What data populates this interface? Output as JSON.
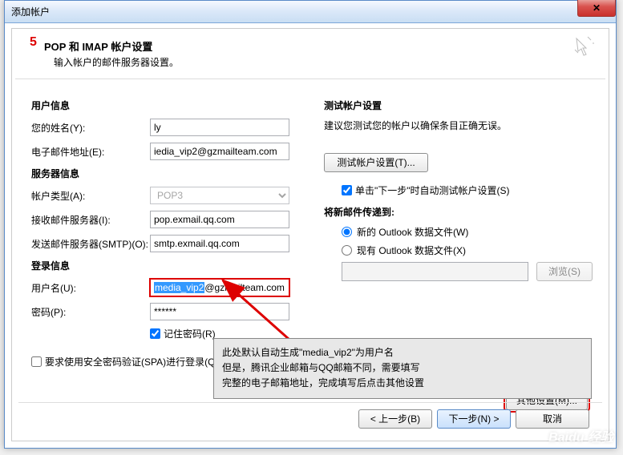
{
  "window": {
    "title": "添加帐户",
    "close_glyph": "✕"
  },
  "step_number": "5",
  "header": {
    "title": "POP 和 IMAP 帐户设置",
    "subtitle": "输入帐户的邮件服务器设置。"
  },
  "left": {
    "user_section": "用户信息",
    "name_label": "您的姓名(Y):",
    "name_value": "ly",
    "email_label": "电子邮件地址(E):",
    "email_value": "iedia_vip2@gzmailteam.com",
    "server_section": "服务器信息",
    "acct_type_label": "帐户类型(A):",
    "acct_type_value": "POP3",
    "incoming_label": "接收邮件服务器(I):",
    "incoming_value": "pop.exmail.qq.com",
    "outgoing_label": "发送邮件服务器(SMTP)(O):",
    "outgoing_value": "smtp.exmail.qq.com",
    "login_section": "登录信息",
    "user_label": "用户名(U):",
    "user_value_sel": "media_vip2",
    "user_value_rest": "@gzmailteam.com",
    "pass_label": "密码(P):",
    "pass_value": "******",
    "remember_label": "记住密码(R)",
    "spa_label": "要求使用安全密码验证(SPA)进行登录(Q)"
  },
  "right": {
    "test_section": "测试帐户设置",
    "test_desc": "建议您测试您的帐户以确保条目正确无误。",
    "test_btn": "测试帐户设置(T)...",
    "auto_test_label": "单击\"下一步\"时自动测试帐户设置(S)",
    "deliver_section": "将新邮件传递到:",
    "radio_new": "新的 Outlook 数据文件(W)",
    "radio_existing": "现有 Outlook 数据文件(X)",
    "browse_btn": "浏览(S)",
    "more_btn": "其他设置(M)..."
  },
  "footer": {
    "back": "< 上一步(B)",
    "next": "下一步(N) >",
    "cancel": "取消"
  },
  "annotation": {
    "l1": "此处默认自动生成\"media_vip2\"为用户名",
    "l2": "但是，腾讯企业邮箱与QQ邮箱不同，需要填写",
    "l3": "完整的电子邮箱地址，完成填写后点击其他设置"
  },
  "watermark": "Baidu 经验"
}
